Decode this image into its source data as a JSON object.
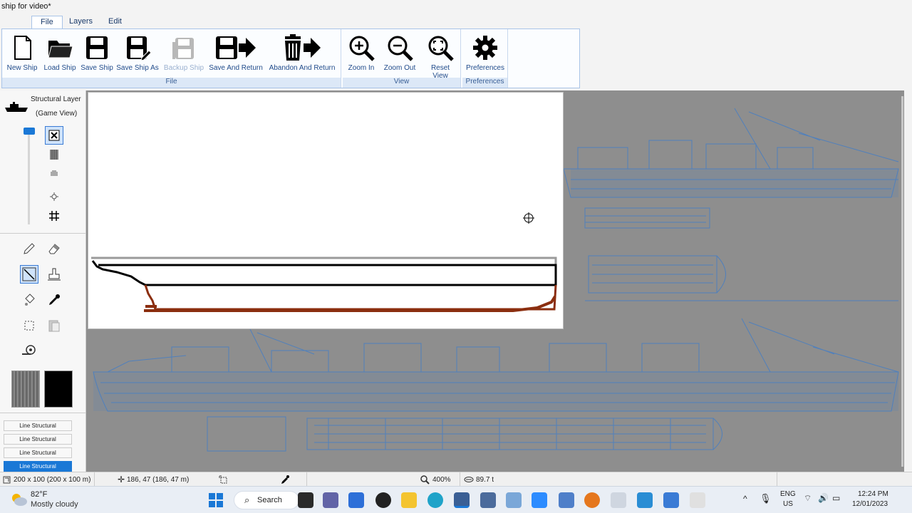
{
  "window": {
    "title": "ship for video*"
  },
  "tabs": [
    {
      "label": "File",
      "active": true
    },
    {
      "label": "Layers",
      "active": false
    },
    {
      "label": "Edit",
      "active": false
    }
  ],
  "ribbon": {
    "groups": {
      "file": "File",
      "view": "View",
      "preferences": "Preferences"
    },
    "buttons": {
      "new_ship": "New Ship",
      "load_ship": "Load Ship",
      "save_ship": "Save Ship",
      "save_ship_as": "Save Ship As",
      "backup_ship": "Backup Ship",
      "save_and_return": "Save And Return",
      "abandon_and_return": "Abandon And Return",
      "zoom_in": "Zoom In",
      "zoom_out": "Zoom Out",
      "reset_view": "Reset View",
      "preferences": "Preferences"
    }
  },
  "left_panel": {
    "layer_title": "Structural Layer",
    "layer_subtitle": "(Game View)",
    "layer_items": [
      "Line Structural",
      "Line Structural",
      "Line Structural",
      "Line Structural"
    ],
    "selected_layer_index": 3
  },
  "status": {
    "size": "200 x 100 (200 x 100 m)",
    "position": "186, 47 (186, 47 m)",
    "zoom": "400%",
    "mass": "89.7 t"
  },
  "taskbar": {
    "weather_temp": "82°F",
    "weather_desc": "Mostly cloudy",
    "search_label": "Search",
    "lang_line1": "ENG",
    "lang_line2": "US",
    "time": "12:24 PM",
    "date": "12/01/2023"
  },
  "colors": {
    "accent": "#1a78d6",
    "hull_outline": "#000000",
    "hull_structure": "#8b2e0f",
    "blueprint": "#4a7fc1"
  }
}
